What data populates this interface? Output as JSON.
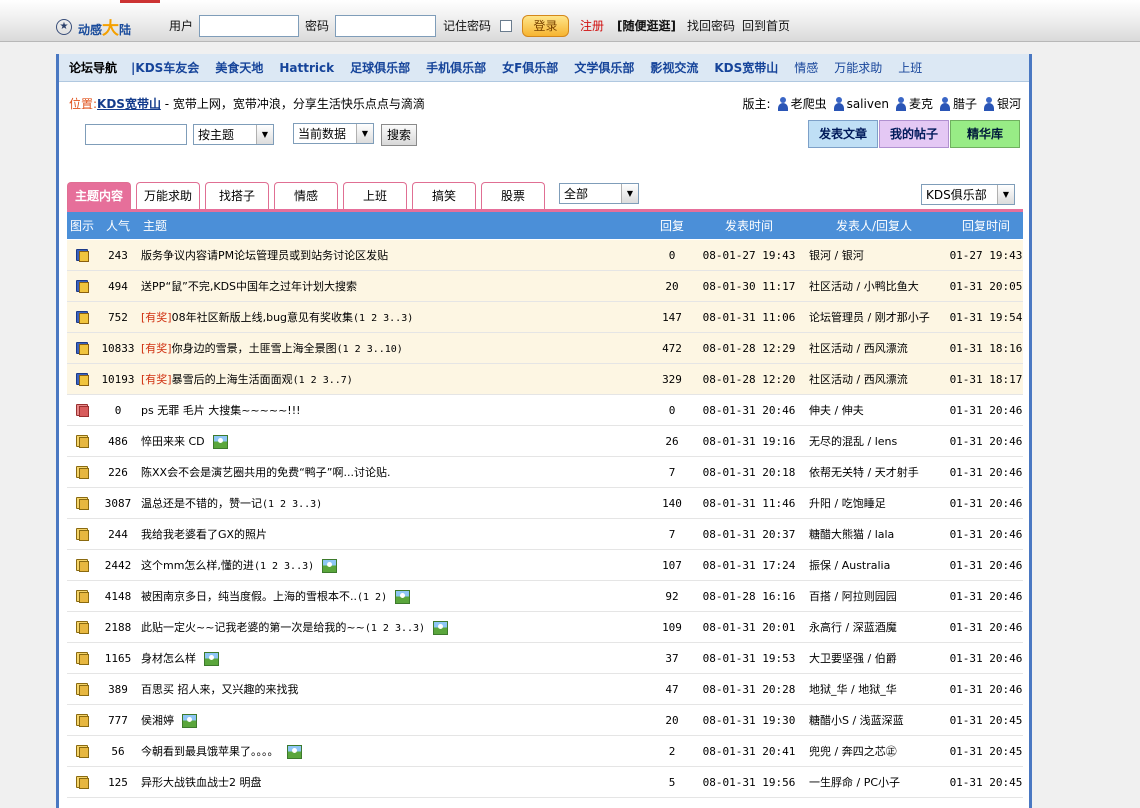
{
  "top": {
    "logo": {
      "pre": "动感",
      "big": "大",
      "post": "陆"
    },
    "user_label": "用户",
    "user_value": "",
    "password_label": "密码",
    "password_value": "",
    "remember_label": "记住密码",
    "login_label": "登录",
    "register_label": "注册",
    "random_label": "[随便逛逛]",
    "forgot_label": "找回密码",
    "home_label": "回到首页"
  },
  "nav": {
    "label": "论坛导航",
    "items": [
      "|KDS车友会",
      "美食天地",
      "Hattrick",
      "足球俱乐部",
      "手机俱乐部",
      "女F俱乐部",
      "文学俱乐部",
      "影视交流",
      "KDS宽带山",
      "情感",
      "万能求助",
      "上班"
    ]
  },
  "location": {
    "prefix": "位置:",
    "name": "KDS宽带山",
    "desc": " - 宽带上网，宽带冲浪，分享生活快乐点点与滴滴"
  },
  "moderators": {
    "label": "版主:",
    "names": [
      "老爬虫",
      "saliven",
      "麦克",
      "腊子",
      "银河"
    ]
  },
  "search": {
    "input_value": "",
    "mode": "按主题",
    "scope": "当前数据",
    "button": "搜索"
  },
  "actions": {
    "post": "发表文章",
    "mine": "我的帖子",
    "digest": "精华库"
  },
  "tabs": [
    "主题内容",
    "万能求助",
    "找搭子",
    "情感",
    "上班",
    "搞笑",
    "股票"
  ],
  "filter": {
    "category": "全部",
    "board": "KDS俱乐部"
  },
  "table": {
    "headers": {
      "icon": "图示",
      "pop": "人气",
      "title": "主题",
      "replies": "回复",
      "time": "发表时间",
      "user": "发表人/回复人",
      "last": "回复时间"
    },
    "rows": [
      {
        "icon": "hot",
        "pop": "243",
        "tag": "",
        "title": "版务争议内容请PM论坛管理员或到站务讨论区发贴",
        "pages": "",
        "pic": false,
        "replies": "0",
        "time": "08-01-27 19:43",
        "user": "银河 / 银河",
        "last": "01-27 19:43",
        "pinned": true
      },
      {
        "icon": "hot",
        "pop": "494",
        "tag": "",
        "title": "送PP“鼠”不完,KDS中国年之过年计划大搜索",
        "pages": "",
        "pic": false,
        "replies": "20",
        "time": "08-01-30 11:17",
        "user": "社区活动 / 小鸭比鱼大",
        "last": "01-31 20:05",
        "pinned": true
      },
      {
        "icon": "hot",
        "pop": "752",
        "tag": "[有奖]",
        "title": "08年社区新版上线,bug意见有奖收集",
        "pages": "(1 2 3..3)",
        "pic": false,
        "replies": "147",
        "time": "08-01-31 11:06",
        "user": "论坛管理员 / 刚才那小子",
        "last": "01-31 19:54",
        "pinned": true
      },
      {
        "icon": "hot",
        "pop": "10833",
        "tag": "[有奖]",
        "title": "你身边的雪景，土匪雪上海全景图",
        "pages": "(1 2 3..10)",
        "pic": false,
        "replies": "472",
        "time": "08-01-28 12:29",
        "user": "社区活动 / 西风漂流",
        "last": "01-31 18:16",
        "pinned": true
      },
      {
        "icon": "hot",
        "pop": "10193",
        "tag": "[有奖]",
        "title": "暴雪后的上海生活面面观",
        "pages": "(1 2 3..7)",
        "pic": false,
        "replies": "329",
        "time": "08-01-28 12:20",
        "user": "社区活动 / 西风漂流",
        "last": "01-31 18:17",
        "pinned": true
      },
      {
        "icon": "red",
        "pop": "0",
        "tag": "",
        "title": "ps 无罪 毛片 大搜集~~~~~!!!",
        "pages": "",
        "pic": false,
        "replies": "0",
        "time": "08-01-31 20:46",
        "user": "伸夫 / 伸夫",
        "last": "01-31 20:46",
        "pinned": false
      },
      {
        "icon": "folder",
        "pop": "486",
        "tag": "",
        "title": "悴田来来 CD",
        "pages": "",
        "pic": true,
        "replies": "26",
        "time": "08-01-31 19:16",
        "user": "无尽的混乱 / lens",
        "last": "01-31 20:46",
        "pinned": false
      },
      {
        "icon": "folder",
        "pop": "226",
        "tag": "",
        "title": "陈XX会不会是演艺圈共用的免费“鸭子”啊...讨论贴.",
        "pages": "",
        "pic": false,
        "replies": "7",
        "time": "08-01-31 20:18",
        "user": "依帮无关特 / 天才射手",
        "last": "01-31 20:46",
        "pinned": false
      },
      {
        "icon": "folder",
        "pop": "3087",
        "tag": "",
        "title": "温总还是不错的，赞一记",
        "pages": "(1 2 3..3)",
        "pic": false,
        "replies": "140",
        "time": "08-01-31 11:46",
        "user": "升阳 / 吃饱睡足",
        "last": "01-31 20:46",
        "pinned": false
      },
      {
        "icon": "folder",
        "pop": "244",
        "tag": "",
        "title": "我给我老婆看了GX的照片",
        "pages": "",
        "pic": false,
        "replies": "7",
        "time": "08-01-31 20:37",
        "user": "糖醋大熊猫 / lala",
        "last": "01-31 20:46",
        "pinned": false
      },
      {
        "icon": "folder",
        "pop": "2442",
        "tag": "",
        "title": "这个mm怎么样,懂的进",
        "pages": "(1 2 3..3)",
        "pic": true,
        "replies": "107",
        "time": "08-01-31 17:24",
        "user": "振保 / Australia",
        "last": "01-31 20:46",
        "pinned": false
      },
      {
        "icon": "folder",
        "pop": "4148",
        "tag": "",
        "title": "被困南京多日，纯当度假。上海的雪根本不..",
        "pages": "(1 2)",
        "pic": true,
        "replies": "92",
        "time": "08-01-28 16:16",
        "user": "百搭 / 阿拉则园园",
        "last": "01-31 20:46",
        "pinned": false
      },
      {
        "icon": "folder",
        "pop": "2188",
        "tag": "",
        "title": "此贴一定火~~记我老婆的第一次是给我的~~",
        "pages": "(1 2 3..3)",
        "pic": true,
        "replies": "109",
        "time": "08-01-31 20:01",
        "user": "永高行 / 深蓝酒魔",
        "last": "01-31 20:46",
        "pinned": false
      },
      {
        "icon": "folder",
        "pop": "1165",
        "tag": "",
        "title": "身材怎么样",
        "pages": "",
        "pic": true,
        "replies": "37",
        "time": "08-01-31 19:53",
        "user": "大卫要坚强 / 伯爵",
        "last": "01-31 20:46",
        "pinned": false
      },
      {
        "icon": "folder",
        "pop": "389",
        "tag": "",
        "title": "百思买 招人来，又兴趣的来找我",
        "pages": "",
        "pic": false,
        "replies": "47",
        "time": "08-01-31 20:28",
        "user": "地狱_华 / 地狱_华",
        "last": "01-31 20:46",
        "pinned": false
      },
      {
        "icon": "folder",
        "pop": "777",
        "tag": "",
        "title": "侯湘婷",
        "pages": "",
        "pic": true,
        "replies": "20",
        "time": "08-01-31 19:30",
        "user": "糖醋小S / 浅蓝深蓝",
        "last": "01-31 20:45",
        "pinned": false
      },
      {
        "icon": "folder",
        "pop": "56",
        "tag": "",
        "title": "今朝看到最具饿苹果了。。。。",
        "pages": "",
        "pic": true,
        "replies": "2",
        "time": "08-01-31 20:41",
        "user": "兜兜 / 奔四之芯㊣",
        "last": "01-31 20:45",
        "pinned": false
      },
      {
        "icon": "folder",
        "pop": "125",
        "tag": "",
        "title": "异形大战铁血战士2 明盘",
        "pages": "",
        "pic": false,
        "replies": "5",
        "time": "08-01-31 19:56",
        "user": "一生脬命 / PC小子",
        "last": "01-31 20:45",
        "pinned": false
      }
    ]
  }
}
